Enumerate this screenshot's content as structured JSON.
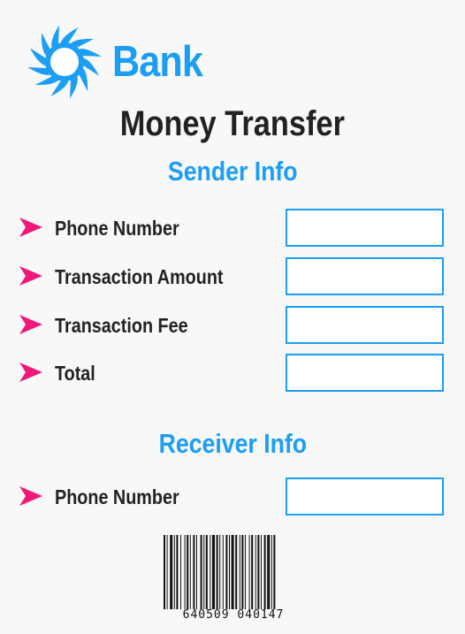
{
  "brand": {
    "name": "Bank",
    "logo_icon": "sun-icon",
    "accent_color": "#1b9ef4"
  },
  "page": {
    "title": "Money Transfer"
  },
  "sender": {
    "heading": "Sender Info",
    "fields": [
      {
        "label": "Phone Number",
        "value": ""
      },
      {
        "label": "Transaction Amount",
        "value": ""
      },
      {
        "label": "Transaction Fee",
        "value": ""
      },
      {
        "label": "Total",
        "value": ""
      }
    ]
  },
  "receiver": {
    "heading": "Receiver Info",
    "fields": [
      {
        "label": "Phone Number",
        "value": ""
      }
    ]
  },
  "bullet": {
    "icon": "arrow-right-icon",
    "color": "#f0187a"
  },
  "barcode": {
    "icon": "barcode-icon",
    "digits": "640509 040147"
  }
}
